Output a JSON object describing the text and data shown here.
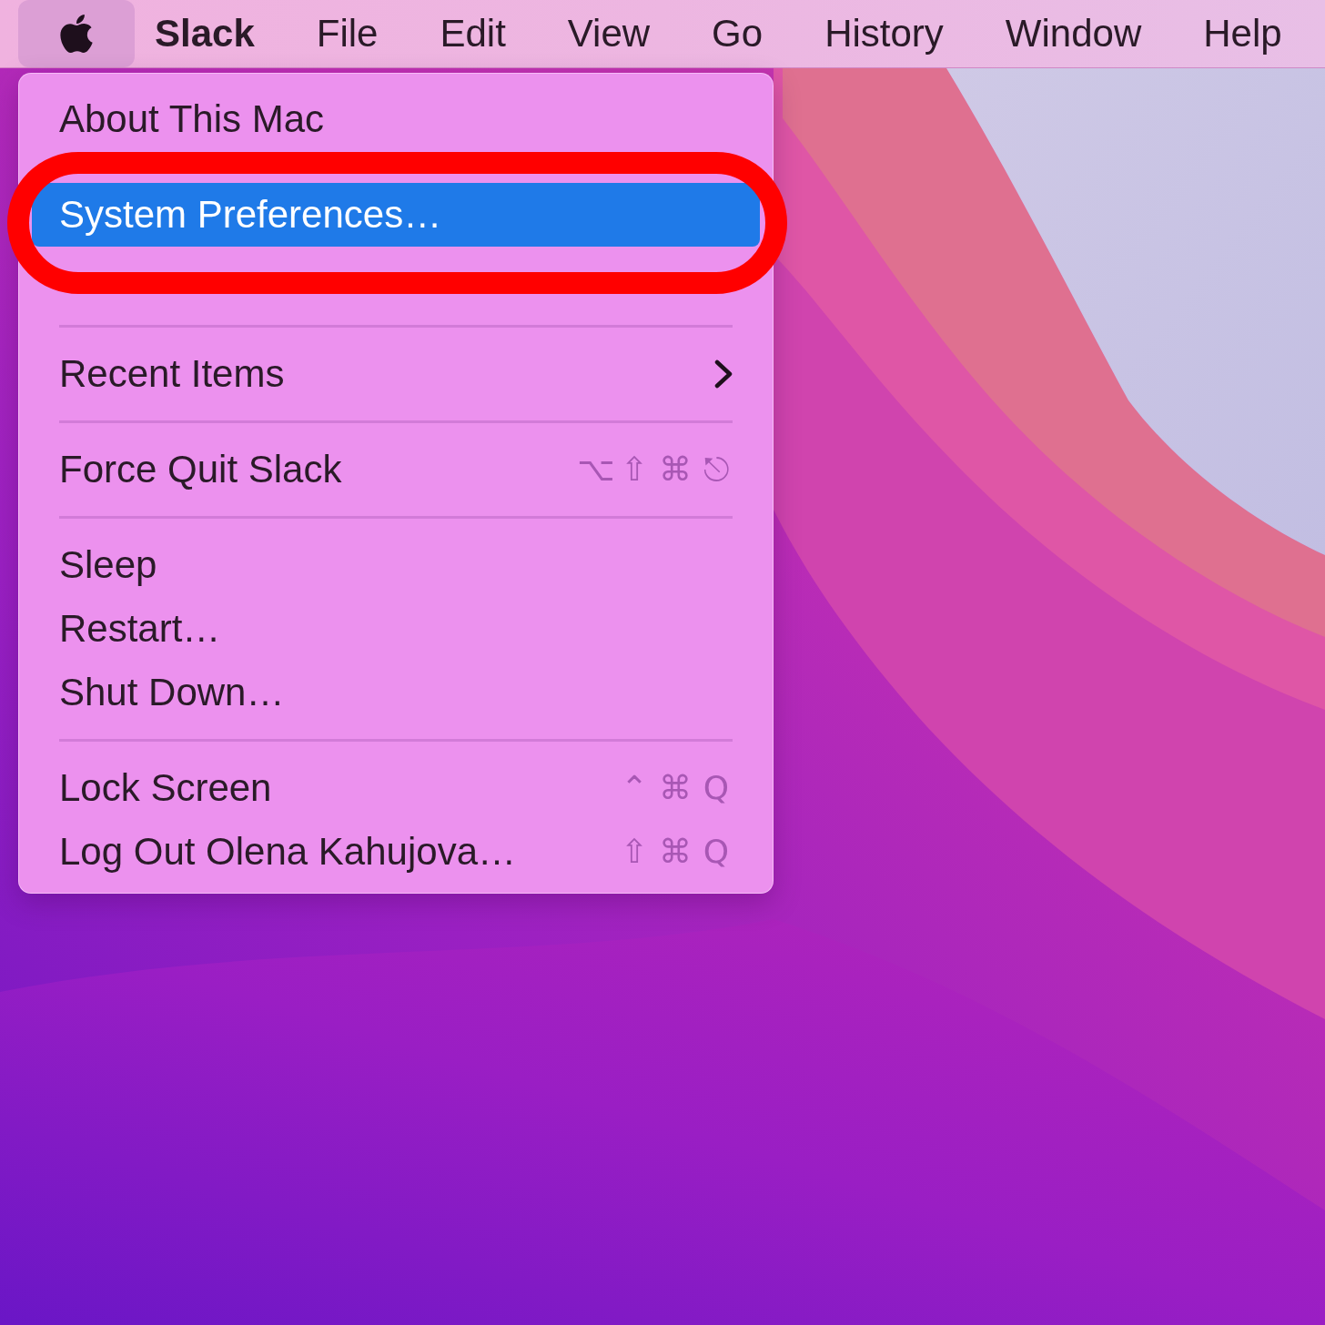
{
  "menu_bar": {
    "apple_menu": {
      "selected": true
    },
    "menus": [
      {
        "label": "Slack",
        "kind": "app",
        "selected": false
      },
      {
        "label": "File",
        "kind": "menu",
        "selected": false
      },
      {
        "label": "Edit",
        "kind": "menu",
        "selected": false
      },
      {
        "label": "View",
        "kind": "menu",
        "selected": false
      },
      {
        "label": "Go",
        "kind": "menu",
        "selected": false
      },
      {
        "label": "History",
        "kind": "menu",
        "selected": false
      },
      {
        "label": "Window",
        "kind": "menu",
        "selected": false
      },
      {
        "label": "Help",
        "kind": "menu",
        "selected": false
      }
    ]
  },
  "apple_menu": {
    "groups": [
      [
        {
          "label": "About This Mac",
          "selected": false,
          "submenu": false
        }
      ],
      [
        {
          "label": "System Preferences…",
          "selected": true,
          "submenu": false
        }
      ],
      [
        {
          "label": "Recent Items",
          "selected": false,
          "submenu": true
        }
      ],
      [
        {
          "label": "Force Quit Slack",
          "selected": false,
          "submenu": false,
          "shortcut": [
            "⌥",
            "⇧",
            "⌘",
            "⎋"
          ]
        }
      ],
      [
        {
          "label": "Sleep",
          "selected": false,
          "submenu": false
        },
        {
          "label": "Restart…",
          "selected": false,
          "submenu": false
        },
        {
          "label": "Shut Down…",
          "selected": false,
          "submenu": false
        }
      ],
      [
        {
          "label": "Lock Screen",
          "selected": false,
          "submenu": false,
          "shortcut": [
            "⌃",
            "⌘",
            "Q"
          ]
        },
        {
          "label": "Log Out Olena Kahujova…",
          "selected": false,
          "submenu": false,
          "shortcut": [
            "⇧",
            "⌘",
            "Q"
          ]
        }
      ]
    ]
  },
  "annotation": {
    "kind": "ring"
  }
}
